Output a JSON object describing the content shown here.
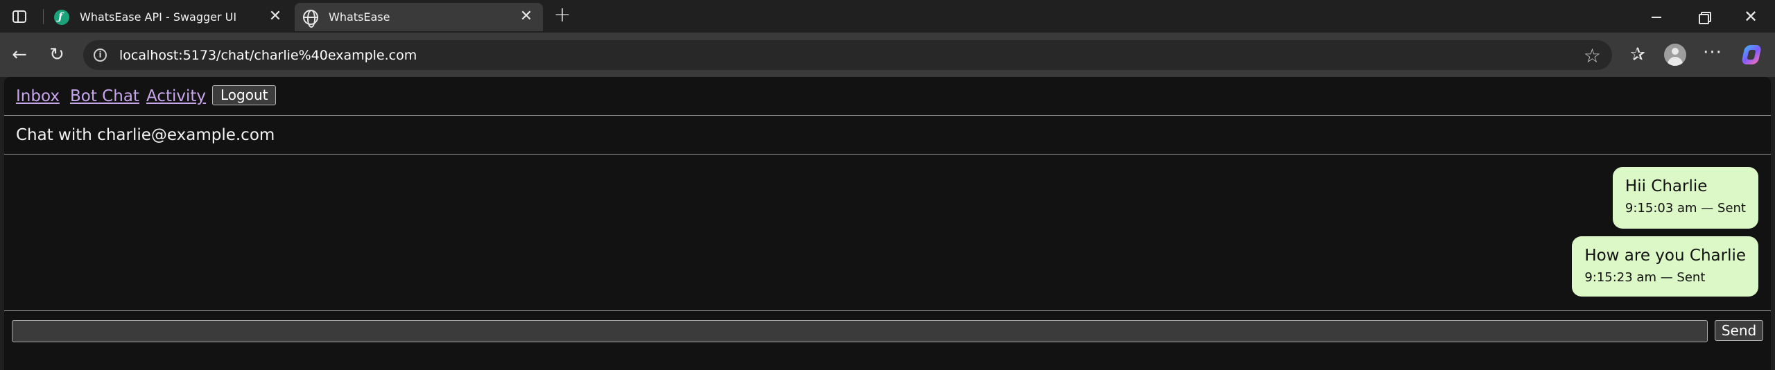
{
  "browser": {
    "tabs": [
      {
        "title": "WhatsEase API - Swagger UI",
        "favicon": "swagger-icon",
        "active": false
      },
      {
        "title": "WhatsEase",
        "favicon": "globe-icon",
        "active": true
      }
    ],
    "address_bar": {
      "url": "localhost:5173/chat/charlie%40example.com"
    },
    "icons": [
      "tab-actions-icon",
      "close-icon",
      "new-tab-icon",
      "back-icon",
      "reload-icon",
      "site-info-icon",
      "star-icon",
      "favorites-icon",
      "profile-avatar",
      "more-icon",
      "copilot-icon",
      "minimize-icon",
      "restore-icon",
      "window-close-icon"
    ]
  },
  "nav": {
    "links": [
      "Inbox",
      "Bot Chat",
      "Activity"
    ],
    "logout_label": "Logout"
  },
  "chat": {
    "title": "Chat with charlie@example.com",
    "messages": [
      {
        "text": "Hii Charlie",
        "meta": "9:15:03 am — Sent"
      },
      {
        "text": "How are you Charlie",
        "meta": "9:15:23 am — Sent"
      }
    ],
    "input_value": "",
    "send_label": "Send"
  },
  "colors": {
    "page_bg": "#121212",
    "link": "#c8a6ee",
    "bubble": "#dcf8c6"
  }
}
